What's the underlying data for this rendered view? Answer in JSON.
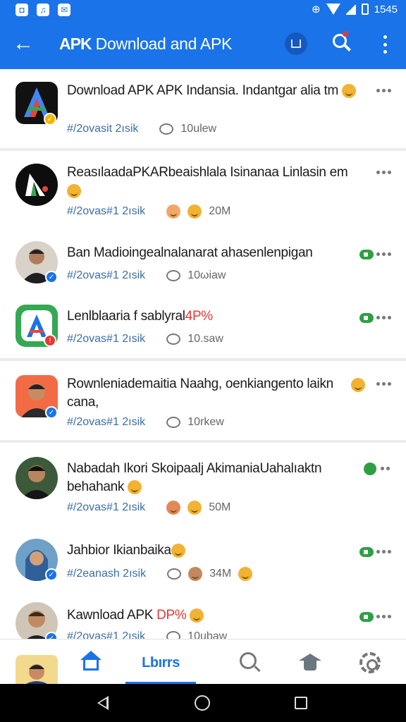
{
  "status_bar": {
    "time": "1545",
    "left_icons": [
      "notification-icon",
      "app-icon",
      "mail-icon"
    ]
  },
  "app_bar": {
    "title_prefix": "APK",
    "title": "Download and APK"
  },
  "feed": {
    "items": [
      {
        "title": "Download APK APK Indansia. Indantgar alia tm",
        "tag": "#/2ovasit 2ısik",
        "count": "10ulew",
        "avatar": "app-logo",
        "avatar_bg": "#111111",
        "badge_color": "#f4b400"
      },
      {
        "title": "ReasılaadaPKARbeaishlala Isinanaa Linlasin em",
        "tag": "#/2ovas#1 2ısik",
        "count": "20M",
        "avatar": "app-logo",
        "avatar_bg": "#0d0d0d"
      },
      {
        "title": "Ban Madioingealnalanarat ahasenlenpigan",
        "tag": "#/2ovas#1 2ısik",
        "count": "10ωiaw",
        "avatar": "person-photo"
      },
      {
        "title_plain": "Lenlblaaria f sablyral",
        "title_accent": "4P%",
        "tag": "#/2ovas#1 2ısik",
        "count": "10.saw",
        "avatar": "app-logo",
        "avatar_bg": "#34a853"
      },
      {
        "title": "Rownleniademaitia Naahg, oenkiangento laikn cana,",
        "tag": "#/2ovas#1 2ısik",
        "count": "10rkew",
        "avatar": "person-photo"
      },
      {
        "title": "Nabadah Ikori Skoipaalj AkimaniaUahalıaktn behahank",
        "tag": "#/2ovas#1 2ısik",
        "count": "50M",
        "avatar": "person-photo"
      },
      {
        "title": "Jahbior Ikianbaika",
        "tag": "#/2eanash 2ısik",
        "count": "34M",
        "avatar": "person-photo"
      },
      {
        "title_plain": "Kawnload APK",
        "title_accent": "DP%",
        "tag": "#/2ovas#1 2ısik",
        "count": "10ubaw",
        "avatar": "person-photo"
      }
    ]
  },
  "bottom_nav": {
    "active_label": "Lbırrs"
  },
  "colors": {
    "primary": "#1a73e8",
    "accent_red": "#e53935",
    "green": "#2ea043"
  }
}
